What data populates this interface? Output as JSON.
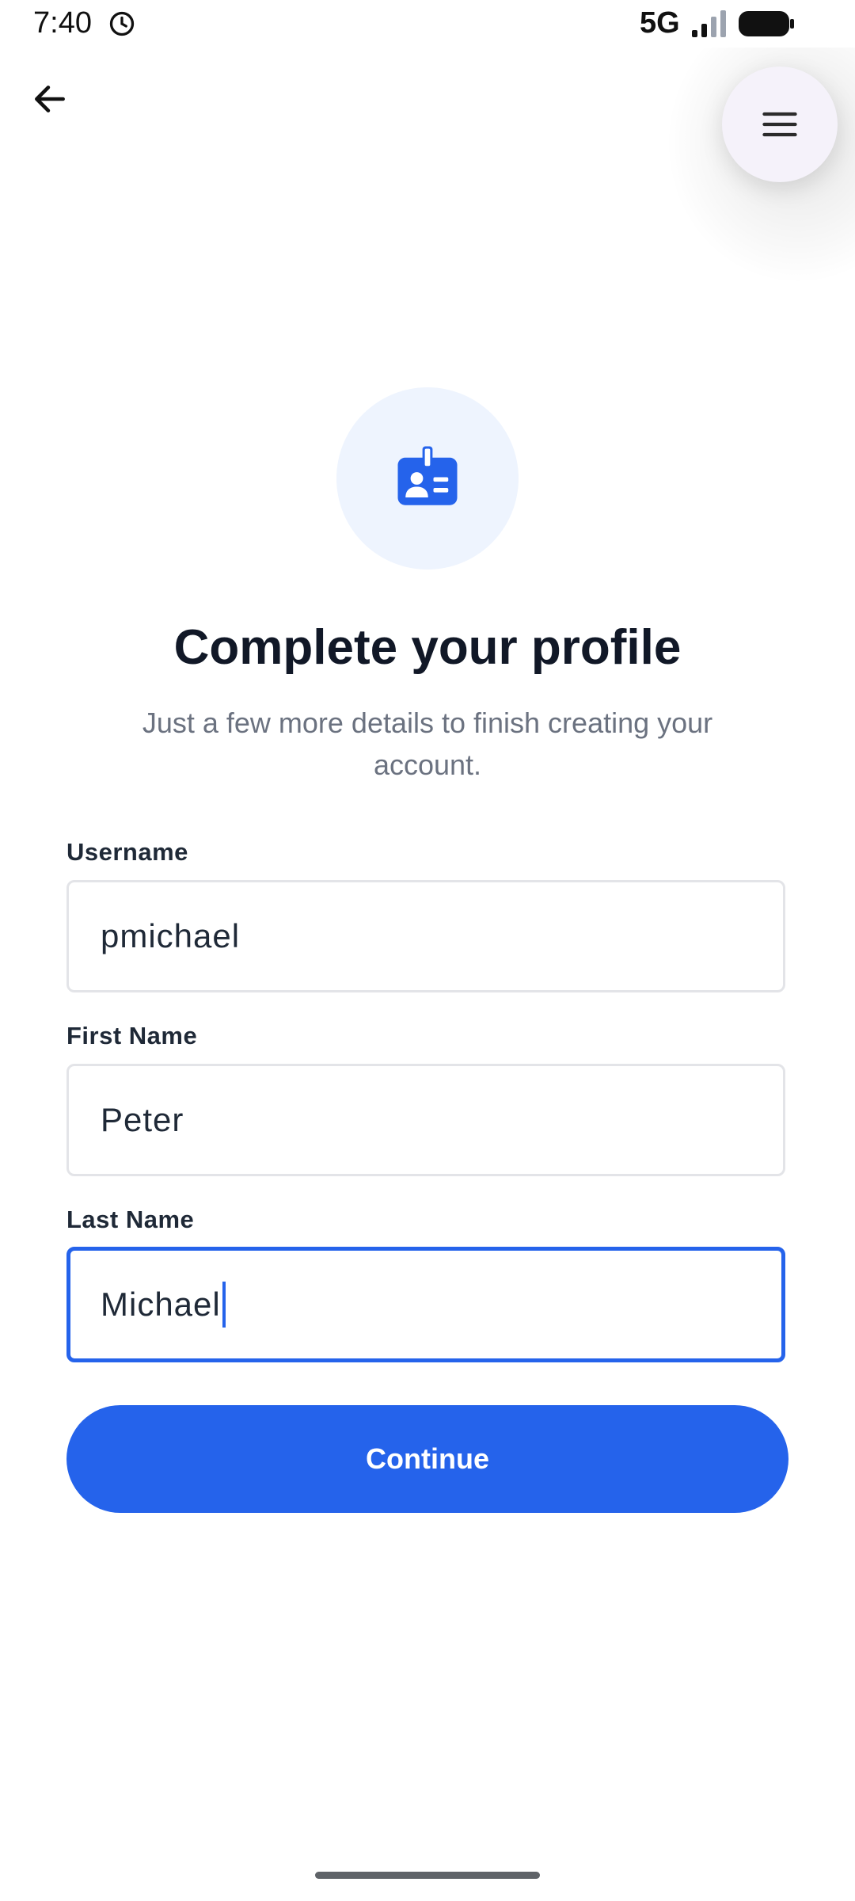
{
  "status_bar": {
    "time": "7:40",
    "network": "5G",
    "alarm_icon": "alarm-clock-icon",
    "signal_icon": "cellular-signal-icon",
    "battery_icon": "battery-full-icon"
  },
  "app_bar": {
    "back_icon": "arrow-left-icon",
    "menu_icon": "hamburger-menu-icon"
  },
  "hero": {
    "icon": "id-badge-icon",
    "title": "Complete your profile",
    "subtitle": "Just a few more details to finish creating your account."
  },
  "form": {
    "username": {
      "label": "Username",
      "value": "pmichael"
    },
    "first_name": {
      "label": "First Name",
      "value": "Peter"
    },
    "last_name": {
      "label": "Last Name",
      "value": "Michael",
      "focused": true
    }
  },
  "actions": {
    "continue_label": "Continue"
  },
  "colors": {
    "accent": "#2563eb",
    "hero_bg": "#eef4fe",
    "title": "#111827",
    "subtitle": "#6b7280",
    "field_border": "#e3e4e8"
  }
}
